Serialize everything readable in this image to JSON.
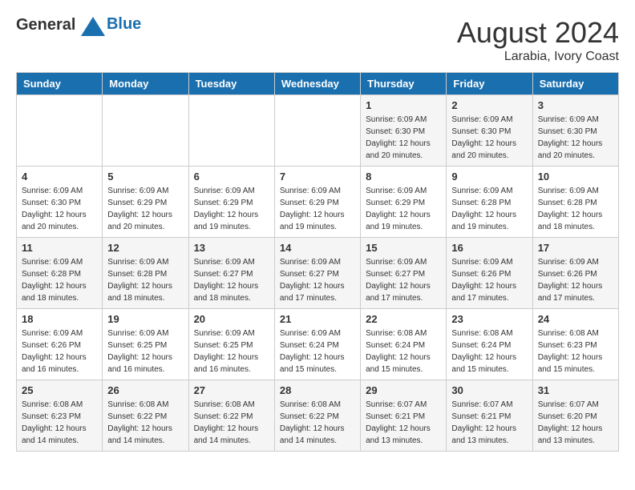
{
  "header": {
    "logo_general": "General",
    "logo_blue": "Blue",
    "month_year": "August 2024",
    "location": "Larabia, Ivory Coast"
  },
  "days_of_week": [
    "Sunday",
    "Monday",
    "Tuesday",
    "Wednesday",
    "Thursday",
    "Friday",
    "Saturday"
  ],
  "weeks": [
    [
      {
        "day": "",
        "info": ""
      },
      {
        "day": "",
        "info": ""
      },
      {
        "day": "",
        "info": ""
      },
      {
        "day": "",
        "info": ""
      },
      {
        "day": "1",
        "info": "Sunrise: 6:09 AM\nSunset: 6:30 PM\nDaylight: 12 hours\nand 20 minutes."
      },
      {
        "day": "2",
        "info": "Sunrise: 6:09 AM\nSunset: 6:30 PM\nDaylight: 12 hours\nand 20 minutes."
      },
      {
        "day": "3",
        "info": "Sunrise: 6:09 AM\nSunset: 6:30 PM\nDaylight: 12 hours\nand 20 minutes."
      }
    ],
    [
      {
        "day": "4",
        "info": "Sunrise: 6:09 AM\nSunset: 6:30 PM\nDaylight: 12 hours\nand 20 minutes."
      },
      {
        "day": "5",
        "info": "Sunrise: 6:09 AM\nSunset: 6:29 PM\nDaylight: 12 hours\nand 20 minutes."
      },
      {
        "day": "6",
        "info": "Sunrise: 6:09 AM\nSunset: 6:29 PM\nDaylight: 12 hours\nand 19 minutes."
      },
      {
        "day": "7",
        "info": "Sunrise: 6:09 AM\nSunset: 6:29 PM\nDaylight: 12 hours\nand 19 minutes."
      },
      {
        "day": "8",
        "info": "Sunrise: 6:09 AM\nSunset: 6:29 PM\nDaylight: 12 hours\nand 19 minutes."
      },
      {
        "day": "9",
        "info": "Sunrise: 6:09 AM\nSunset: 6:28 PM\nDaylight: 12 hours\nand 19 minutes."
      },
      {
        "day": "10",
        "info": "Sunrise: 6:09 AM\nSunset: 6:28 PM\nDaylight: 12 hours\nand 18 minutes."
      }
    ],
    [
      {
        "day": "11",
        "info": "Sunrise: 6:09 AM\nSunset: 6:28 PM\nDaylight: 12 hours\nand 18 minutes."
      },
      {
        "day": "12",
        "info": "Sunrise: 6:09 AM\nSunset: 6:28 PM\nDaylight: 12 hours\nand 18 minutes."
      },
      {
        "day": "13",
        "info": "Sunrise: 6:09 AM\nSunset: 6:27 PM\nDaylight: 12 hours\nand 18 minutes."
      },
      {
        "day": "14",
        "info": "Sunrise: 6:09 AM\nSunset: 6:27 PM\nDaylight: 12 hours\nand 17 minutes."
      },
      {
        "day": "15",
        "info": "Sunrise: 6:09 AM\nSunset: 6:27 PM\nDaylight: 12 hours\nand 17 minutes."
      },
      {
        "day": "16",
        "info": "Sunrise: 6:09 AM\nSunset: 6:26 PM\nDaylight: 12 hours\nand 17 minutes."
      },
      {
        "day": "17",
        "info": "Sunrise: 6:09 AM\nSunset: 6:26 PM\nDaylight: 12 hours\nand 17 minutes."
      }
    ],
    [
      {
        "day": "18",
        "info": "Sunrise: 6:09 AM\nSunset: 6:26 PM\nDaylight: 12 hours\nand 16 minutes."
      },
      {
        "day": "19",
        "info": "Sunrise: 6:09 AM\nSunset: 6:25 PM\nDaylight: 12 hours\nand 16 minutes."
      },
      {
        "day": "20",
        "info": "Sunrise: 6:09 AM\nSunset: 6:25 PM\nDaylight: 12 hours\nand 16 minutes."
      },
      {
        "day": "21",
        "info": "Sunrise: 6:09 AM\nSunset: 6:24 PM\nDaylight: 12 hours\nand 15 minutes."
      },
      {
        "day": "22",
        "info": "Sunrise: 6:08 AM\nSunset: 6:24 PM\nDaylight: 12 hours\nand 15 minutes."
      },
      {
        "day": "23",
        "info": "Sunrise: 6:08 AM\nSunset: 6:24 PM\nDaylight: 12 hours\nand 15 minutes."
      },
      {
        "day": "24",
        "info": "Sunrise: 6:08 AM\nSunset: 6:23 PM\nDaylight: 12 hours\nand 15 minutes."
      }
    ],
    [
      {
        "day": "25",
        "info": "Sunrise: 6:08 AM\nSunset: 6:23 PM\nDaylight: 12 hours\nand 14 minutes."
      },
      {
        "day": "26",
        "info": "Sunrise: 6:08 AM\nSunset: 6:22 PM\nDaylight: 12 hours\nand 14 minutes."
      },
      {
        "day": "27",
        "info": "Sunrise: 6:08 AM\nSunset: 6:22 PM\nDaylight: 12 hours\nand 14 minutes."
      },
      {
        "day": "28",
        "info": "Sunrise: 6:08 AM\nSunset: 6:22 PM\nDaylight: 12 hours\nand 14 minutes."
      },
      {
        "day": "29",
        "info": "Sunrise: 6:07 AM\nSunset: 6:21 PM\nDaylight: 12 hours\nand 13 minutes."
      },
      {
        "day": "30",
        "info": "Sunrise: 6:07 AM\nSunset: 6:21 PM\nDaylight: 12 hours\nand 13 minutes."
      },
      {
        "day": "31",
        "info": "Sunrise: 6:07 AM\nSunset: 6:20 PM\nDaylight: 12 hours\nand 13 minutes."
      }
    ]
  ]
}
